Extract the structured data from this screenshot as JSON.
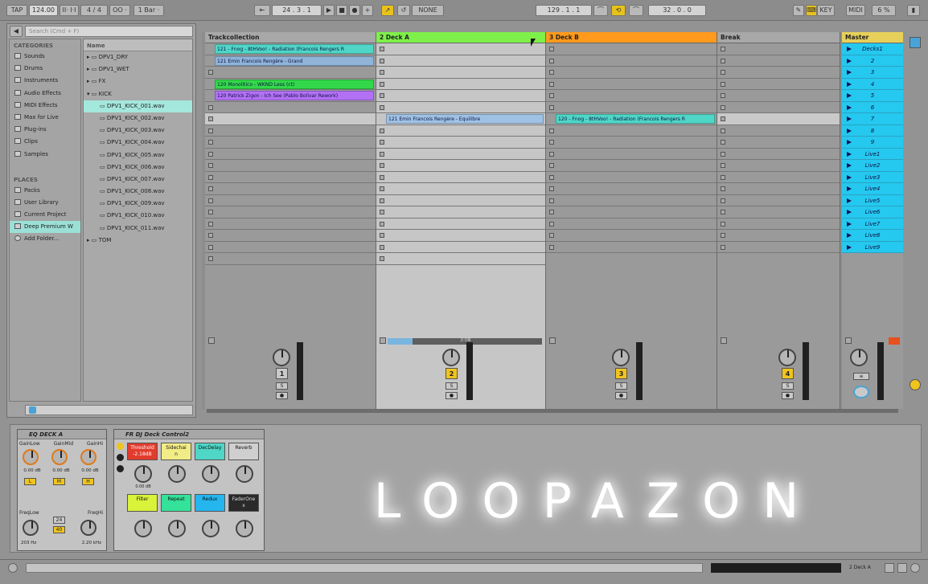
{
  "transport": {
    "tap": "TAP",
    "tempo": "124.00",
    "nudge": "II· I·I",
    "signature": "4 / 4",
    "quant_left": "OO ·",
    "bar": "1 Bar ·",
    "position": "24 . 3 . 1",
    "end_position": "129 . 1 . 1",
    "loop_len": "32 . 0 . 0",
    "none_label": "NONE",
    "key": "KEY",
    "midi": "MIDI",
    "cpu": "6 %"
  },
  "browser": {
    "search_placeholder": "Search (Cmd + F)",
    "categories_header": "CATEGORIES",
    "categories": [
      "Sounds",
      "Drums",
      "Instruments",
      "Audio Effects",
      "MIDI Effects",
      "Max for Live",
      "Plug-ins",
      "Clips",
      "Samples"
    ],
    "places_header": "PLACES",
    "places": [
      "Packs",
      "User Library",
      "Current Project",
      "Deep Premium W",
      "Add Folder..."
    ],
    "files_header": "Name",
    "files": [
      "DPV1_DRY",
      "DPV1_WET",
      "FX",
      "KICK",
      "DPV1_KICK_001.wav",
      "DPV1_KICK_002.wav",
      "DPV1_KICK_003.wav",
      "DPV1_KICK_004.wav",
      "DPV1_KICK_005.wav",
      "DPV1_KICK_006.wav",
      "DPV1_KICK_007.wav",
      "DPV1_KICK_008.wav",
      "DPV1_KICK_009.wav",
      "DPV1_KICK_010.wav",
      "DPV1_KICK_011.wav",
      "TOM"
    ]
  },
  "tracks": {
    "t1": {
      "name": "Trackcollection",
      "number": "1"
    },
    "t2": {
      "name": "2 Deck A",
      "number": "2",
      "color": "#7ef04a"
    },
    "t3": {
      "name": "3 Deck B",
      "number": "3",
      "color": "#ff9a1c"
    },
    "t4": {
      "name": "Break",
      "number": "4"
    },
    "master": {
      "name": "Master",
      "scenes": [
        "Decks1",
        "2",
        "3",
        "4",
        "5",
        "6",
        "7",
        "8",
        "9",
        "Live1",
        "Live2",
        "Live3",
        "Live4",
        "Live5",
        "Live6",
        "Live7",
        "Live8",
        "Live9"
      ]
    }
  },
  "clips": {
    "c1": "121 - Fnog - 8tHVoo! - Radiation (Francois Rengers R",
    "c2": "121 Emin Francois Rengère - Grand",
    "c3": "120 Monolitico - WKND Less (ct)",
    "c4": "120 Patrick Zigon - Ich See (Pablo Bolivar Rework)",
    "c5": "121 Emin Francois Rengère - Equilibre",
    "c6": "120 - Fnog - 8tHVoo! - Radiation (Francois Rengers R"
  },
  "progress_label": "3:08",
  "devices": {
    "eq": {
      "title": "EQ DECK A",
      "labels": [
        "GainLow",
        "GainMid",
        "GainHi"
      ],
      "values": [
        "0.00 dB",
        "0.00 dB",
        "0.00 dB"
      ],
      "freq_labels": [
        "FreqLow",
        "FreqHi"
      ],
      "freq_values": [
        "203 Hz",
        "2.20 kHz"
      ],
      "nums": [
        "L",
        "M",
        "H"
      ],
      "mid": [
        "24",
        "40"
      ]
    },
    "rack": {
      "title": "FR DJ Deck Control2",
      "macros": [
        "Threshold\n-2.18dB",
        "Sidechai\nn",
        "DecDelay",
        "Reverb",
        "Filter",
        "Repeat",
        "Redux",
        "FaderOne\nx"
      ],
      "knob_values": [
        "0.00 dB",
        "",
        "",
        "",
        "",
        "",
        "",
        ""
      ]
    }
  },
  "brand": "LOOPAZON",
  "status_track": "2 Deck A",
  "colors": {
    "green": "#7ef04a",
    "orange": "#ff9a1c",
    "cyan": "#25c8ef",
    "purple": "#b271f5",
    "teal": "#4fd6c6",
    "yellow": "#efc41e"
  }
}
